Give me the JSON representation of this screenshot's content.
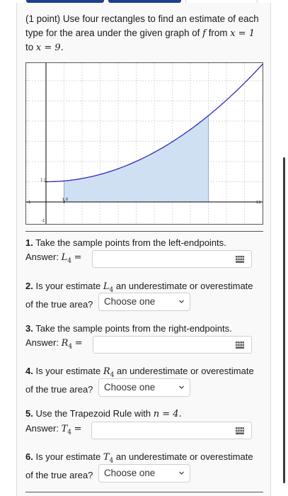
{
  "problem": {
    "points": "(1 point)",
    "text_a": "Use four rectangles to find an estimate of each type for the area under the given graph of",
    "f": "f",
    "text_b": "from",
    "x1": "x = 1",
    "text_c": "to",
    "x2": "x = 9."
  },
  "graph": {
    "tick_y": "1.0",
    "tick_x": "1.0",
    "xmin_label": "-1",
    "xmax_label": "11",
    "ymin_label": "-1",
    "colors": {
      "curve": "#2b2bbd",
      "fill": "#cfe0f3",
      "grid": "#c8c8c8",
      "axis": "#000000"
    }
  },
  "questions": [
    {
      "num": "1.",
      "text": "Take the sample points from the left-endpoints.",
      "answer_label": "Answer:",
      "var": "L",
      "sub": "4",
      "eq": "=",
      "value": ""
    },
    {
      "num": "2.",
      "text_a": "Is your estimate",
      "var": "L",
      "sub": "4",
      "text_b": "an underestimate or overestimate",
      "text_c": "of the true area?",
      "select": "Choose one"
    },
    {
      "num": "3.",
      "text": "Take the sample points from the right-endpoints.",
      "answer_label": "Answer:",
      "var": "R",
      "sub": "4",
      "eq": "=",
      "value": ""
    },
    {
      "num": "4.",
      "text_a": "Is your estimate",
      "var": "R",
      "sub": "4",
      "text_b": "an underestimate or overestimate",
      "text_c": "of the true area?",
      "select": "Choose one"
    },
    {
      "num": "5.",
      "text_a": "Use the Trapezoid Rule with",
      "n": "n = 4.",
      "answer_label": "Answer:",
      "var": "T",
      "sub": "4",
      "eq": "=",
      "value": ""
    },
    {
      "num": "6.",
      "text_a": "Is your estimate",
      "var": "T",
      "sub": "4",
      "text_b": "an underestimate or overestimate",
      "text_c": "of the true area?",
      "select": "Choose one"
    }
  ]
}
